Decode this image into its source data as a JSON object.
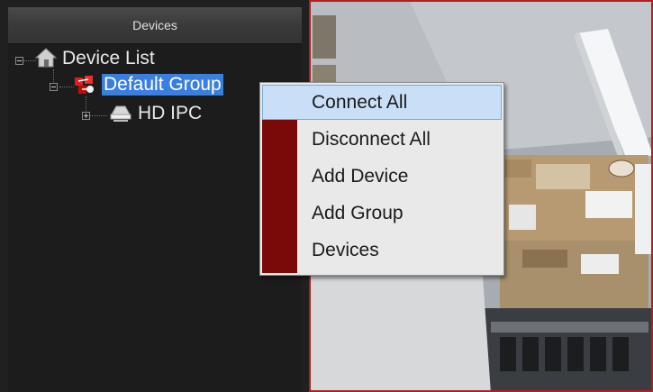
{
  "panel": {
    "title": "Devices"
  },
  "tree": {
    "root": {
      "label": "Device List",
      "icon": "home-icon",
      "expanded": true
    },
    "group": {
      "label": "Default Group",
      "icon": "group-icon",
      "expanded": true,
      "selected": true
    },
    "device": {
      "label": "HD IPC",
      "icon": "ip-camera-icon",
      "expanded": false
    }
  },
  "context_menu": {
    "items": [
      {
        "label": "Connect All",
        "highlighted": true
      },
      {
        "label": "Disconnect All",
        "highlighted": false
      },
      {
        "label": "Add Device",
        "highlighted": false
      },
      {
        "label": "Add Group",
        "highlighted": false
      },
      {
        "label": "Devices",
        "highlighted": false
      }
    ]
  },
  "colors": {
    "selection": "#3a7fe0",
    "menu_gutter": "#7a0a0a",
    "menu_highlight": "#c9dff7",
    "video_border": "#b02020"
  }
}
